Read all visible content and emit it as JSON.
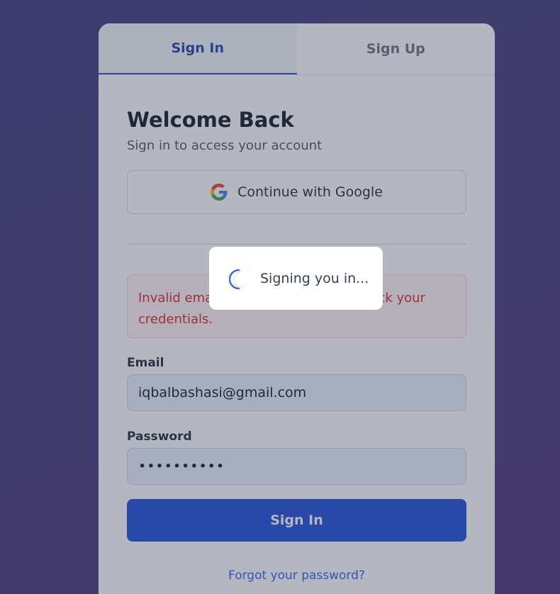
{
  "tabs": {
    "sign_in": "Sign In",
    "sign_up": "Sign Up",
    "active": "sign_in"
  },
  "form": {
    "title": "Welcome Back",
    "subtitle": "Sign in to access your account",
    "google_button": "Continue with Google",
    "error_message": "Invalid email or password. Please check your credentials.",
    "email_label": "Email",
    "email_value": "iqbalbashasi@gmail.com",
    "password_label": "Password",
    "password_value": "••••••••••",
    "submit_button": "Sign In",
    "forgot_link": "Forgot your password?"
  },
  "loading": {
    "text": "Signing you in...",
    "icon": "spinner-icon"
  },
  "colors": {
    "primary": "#1d4ed8",
    "error": "#dc2626",
    "background_gradient_start": "#3e3a80",
    "background_gradient_end": "#4a3477"
  },
  "icons": {
    "google": "google-icon"
  }
}
